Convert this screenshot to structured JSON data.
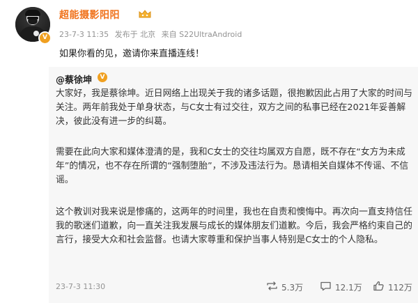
{
  "post": {
    "username": "超能摄影阳阳",
    "meta": {
      "time": "23-7-3 11:35",
      "published_in": "发布于 北京",
      "device": "来自 S22UltraAndroid"
    },
    "text": "如果你看的见，邀请你来直播连线！"
  },
  "repost": {
    "author": "@蔡徐坤",
    "paragraphs": [
      "大家好，我是蔡徐坤。近日网络上出现关于我的诸多话题，很抱歉因此占用了大家的时间与关注。两年前我处于单身状态，与C女士有过交往，双方之间的私事已经在2021年妥善解决，彼此没有进一步的纠葛。",
      "需要在此向大家和媒体澄清的是，我和C女士的交往均属双方自愿，既不存在“女方为未成年”的情况，也不存在所谓的“强制堕胎”，不涉及违法行为。恳请相关自媒体不传谣、不信谣。",
      "这个教训对我来说是惨痛的，这两年的时间里，我也在自责和懊悔中。再次向一直支持信任我的歌迷们道歉，向一直关注我发展与成长的媒体朋友们道歉。今后，我会严格约束自己的言行，接受大众和社会监督。也请大家尊重和保护当事人特别是C女士的个人隐私。"
    ],
    "time": "23-7-3 11:30",
    "actions": {
      "reposts": "5.3万",
      "comments": "12.1万",
      "likes": "112万"
    }
  },
  "icons": [
    "avatar",
    "verified-badge",
    "vip-crown-icon",
    "repost-icon",
    "comment-icon",
    "like-icon"
  ],
  "colors": {
    "username": "#f0721b",
    "meta": "#939393",
    "repost_bg": "#f7f7f7",
    "badge": "#f0a020"
  }
}
